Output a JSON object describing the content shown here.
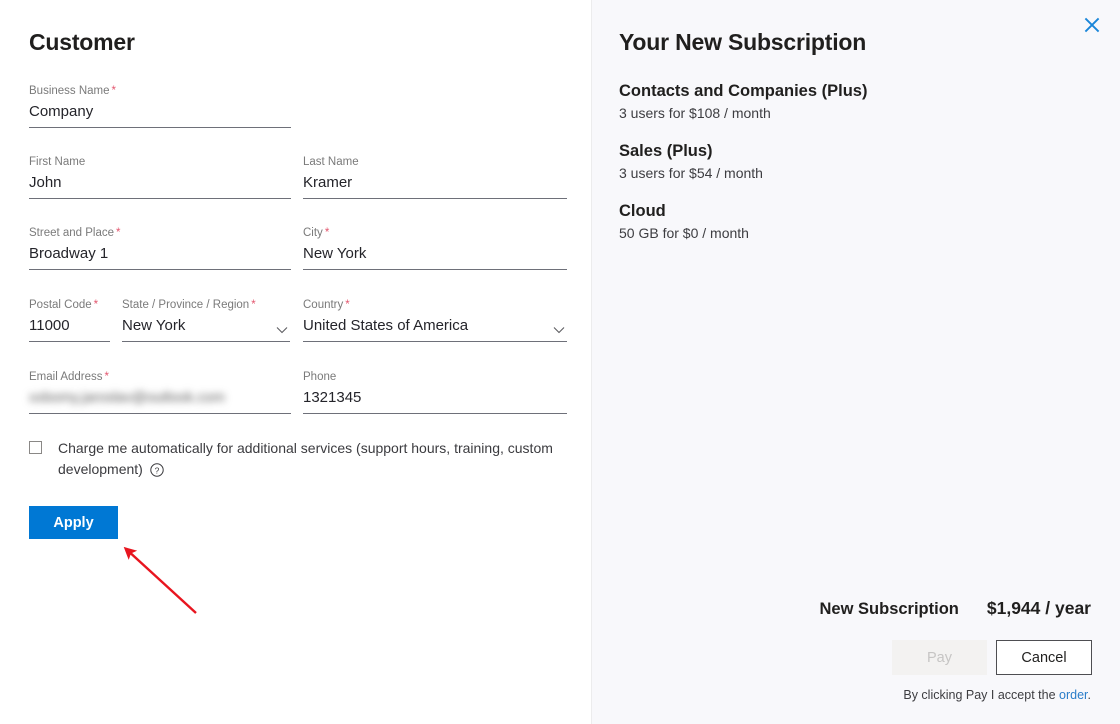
{
  "left": {
    "title": "Customer",
    "fields": [
      {
        "label": "Business Name",
        "required": "*",
        "value": "Company"
      },
      {
        "label": "First Name",
        "required": "",
        "value": "John"
      },
      {
        "label": "Last Name",
        "required": "",
        "value": "Kramer"
      },
      {
        "label": "Street and Place",
        "required": "*",
        "value": "Broadway 1"
      },
      {
        "label": "City",
        "required": "*",
        "value": "New York"
      },
      {
        "label": "Postal Code",
        "required": "*",
        "value": "11000"
      },
      {
        "label": "State / Province / Region",
        "required": "*",
        "value": "New York"
      },
      {
        "label": "Country",
        "required": "*",
        "value": "United States of America"
      },
      {
        "label": "Email Address",
        "required": "*",
        "value": "xxbomy.jaroslav@outlook.com"
      },
      {
        "label": "Phone",
        "required": "",
        "value": "1321345"
      }
    ],
    "checkbox": {
      "label": "Charge me automatically for additional services (support hours, training, custom development)",
      "checked": false,
      "help_icon": "help-circle-icon"
    },
    "apply_label": "Apply",
    "annotation": {
      "type": "arrow",
      "color": "#e8151f",
      "points_to": "apply-button"
    }
  },
  "right": {
    "title": "Your New Subscription",
    "close_icon": "close-icon",
    "accent_color": "#0078d4",
    "items": [
      {
        "name": "Contacts and Companies (Plus)",
        "detail": "3 users for $108 / month"
      },
      {
        "name": "Sales (Plus)",
        "detail": "3 users for $54 / month"
      },
      {
        "name": "Cloud",
        "detail": "50 GB for $0 / month"
      }
    ],
    "total": {
      "label": "New Subscription",
      "value": "$1,944 / year"
    },
    "pay_label": "Pay",
    "cancel_label": "Cancel",
    "legal": {
      "prefix": "By clicking Pay I accept the ",
      "link": "order",
      "suffix": "."
    }
  }
}
